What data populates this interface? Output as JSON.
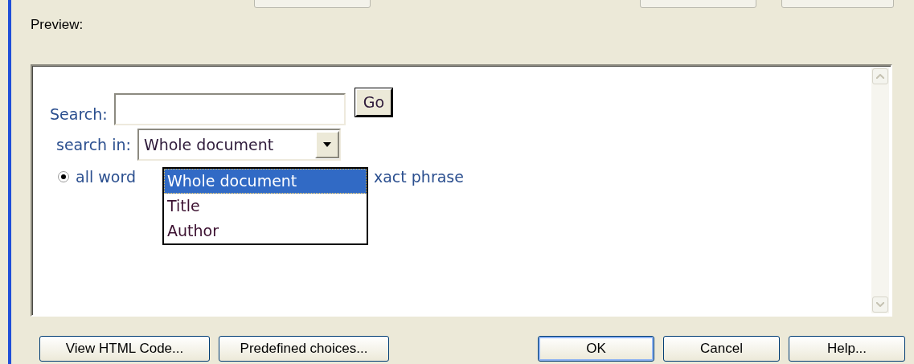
{
  "top_buttons": [
    {
      "kind": "cut"
    },
    {
      "kind": "cut"
    },
    {
      "kind": "cut"
    }
  ],
  "preview": {
    "label": "Preview:",
    "search": {
      "label": "Search:",
      "button": "Go"
    },
    "search_in": {
      "label": "search in:",
      "value": "Whole document",
      "expanded": true,
      "options": [
        {
          "label": "Whole document",
          "selected": true
        },
        {
          "label": "Title",
          "selected": false
        },
        {
          "label": "Author",
          "selected": false
        }
      ]
    },
    "radios": [
      {
        "label": "all word",
        "selected": true
      },
      {
        "label": "xact phrase"
      }
    ]
  },
  "buttons": [
    {
      "label": "View HTML Code...",
      "default": false
    },
    {
      "label": "Predefined choices...",
      "default": false
    },
    {
      "label": "OK",
      "default": true
    },
    {
      "label": "Cancel",
      "default": false
    },
    {
      "label": "Help...",
      "default": false
    }
  ]
}
